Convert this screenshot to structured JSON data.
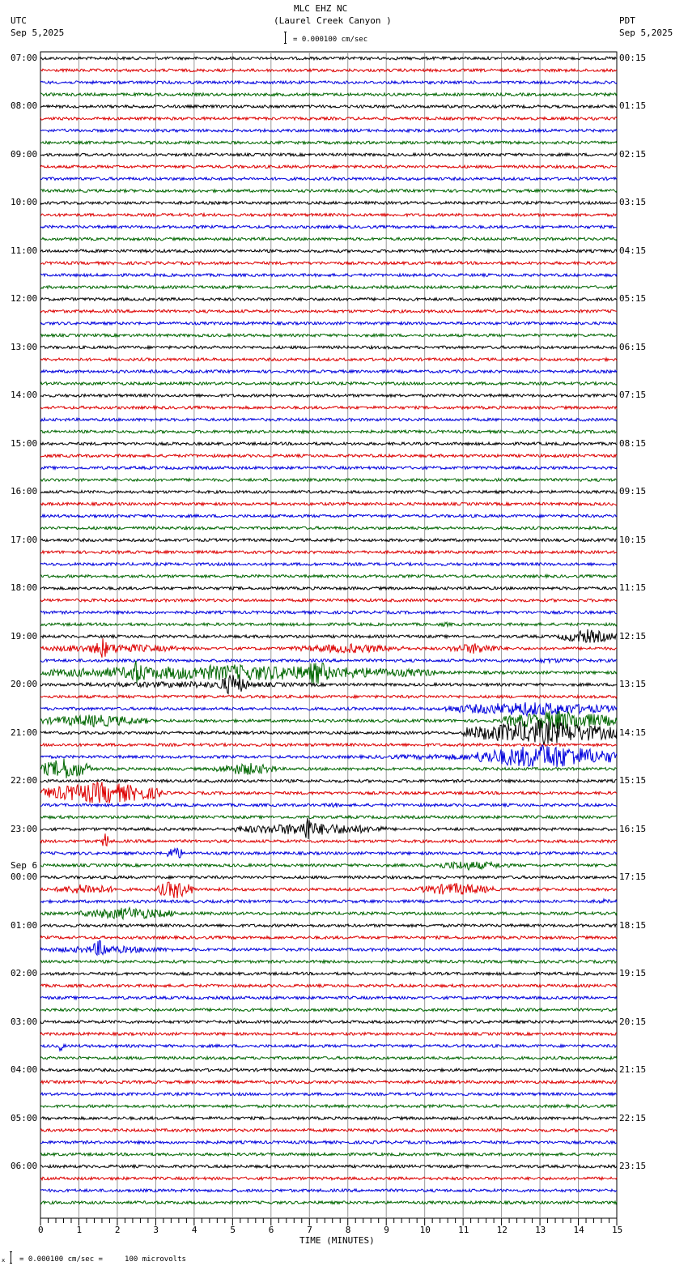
{
  "header": {
    "station": "MLC EHZ NC",
    "location": "(Laurel Creek Canyon )",
    "left_tz": "UTC",
    "left_date": "Sep 5,2025",
    "right_tz": "PDT",
    "right_date": "Sep 5,2025",
    "scale": "= 0.000100 cm/sec"
  },
  "footer": {
    "scale": "= 0.000100 cm/sec =     100 microvolts",
    "mark": "x"
  },
  "colors": [
    "#000000",
    "#dd0000",
    "#0000dd",
    "#006600"
  ],
  "chart_data": {
    "type": "line",
    "title": "MLC EHZ NC (Laurel Creek Canyon )",
    "xlabel": "TIME (MINUTES)",
    "xlim": [
      0,
      15
    ],
    "x_ticks": [
      "0",
      "1",
      "2",
      "3",
      "4",
      "5",
      "6",
      "7",
      "8",
      "9",
      "10",
      "11",
      "12",
      "13",
      "14",
      "15"
    ],
    "traces_per_hour": 4,
    "minutes_per_trace": 15,
    "next_day_label": "Sep 6",
    "next_day_hour_index": 17,
    "left_labels": [
      "07:00",
      "08:00",
      "09:00",
      "10:00",
      "11:00",
      "12:00",
      "13:00",
      "14:00",
      "15:00",
      "16:00",
      "17:00",
      "18:00",
      "19:00",
      "20:00",
      "21:00",
      "22:00",
      "23:00",
      "00:00",
      "01:00",
      "02:00",
      "03:00",
      "04:00",
      "05:00",
      "06:00"
    ],
    "right_labels": [
      "00:15",
      "01:15",
      "02:15",
      "03:15",
      "04:15",
      "05:15",
      "06:15",
      "07:15",
      "08:15",
      "09:15",
      "10:15",
      "11:15",
      "12:15",
      "13:15",
      "14:15",
      "15:15",
      "16:15",
      "17:15",
      "18:15",
      "19:15",
      "20:15",
      "21:15",
      "22:15",
      "23:15"
    ],
    "events": [
      {
        "trace": 22,
        "start": 4.6,
        "end": 5.0,
        "amplitude": 2
      },
      {
        "trace": 38,
        "start": 4.6,
        "end": 5.2,
        "amplitude": 2
      },
      {
        "trace": 47,
        "start": 10.3,
        "end": 10.8,
        "amplitude": 3
      },
      {
        "trace": 48,
        "start": 13.5,
        "end": 15,
        "amplitude": 9
      },
      {
        "trace": 49,
        "start": 0,
        "end": 3.8,
        "amplitude": 6
      },
      {
        "trace": 49,
        "start": 1.4,
        "end": 1.8,
        "amplitude": 14
      },
      {
        "trace": 49,
        "start": 6.5,
        "end": 9.6,
        "amplitude": 6
      },
      {
        "trace": 49,
        "start": 10.6,
        "end": 12,
        "amplitude": 7
      },
      {
        "trace": 50,
        "start": 11.5,
        "end": 15,
        "amplitude": 3
      },
      {
        "trace": 51,
        "start": 0,
        "end": 10.3,
        "amplitude": 10
      },
      {
        "trace": 51,
        "start": 2.2,
        "end": 2.8,
        "amplitude": 16
      },
      {
        "trace": 51,
        "start": 6.8,
        "end": 7.6,
        "amplitude": 16
      },
      {
        "trace": 52,
        "start": 0,
        "end": 8,
        "amplitude": 4
      },
      {
        "trace": 52,
        "start": 4.6,
        "end": 5.4,
        "amplitude": 14
      },
      {
        "trace": 54,
        "start": 10.5,
        "end": 15,
        "amplitude": 9
      },
      {
        "trace": 55,
        "start": 0,
        "end": 2.8,
        "amplitude": 8
      },
      {
        "trace": 55,
        "start": 12,
        "end": 15,
        "amplitude": 13
      },
      {
        "trace": 56,
        "start": 11,
        "end": 15,
        "amplitude": 16
      },
      {
        "trace": 58,
        "start": 8,
        "end": 15,
        "amplitude": 4
      },
      {
        "trace": 58,
        "start": 11.3,
        "end": 15,
        "amplitude": 16
      },
      {
        "trace": 59,
        "start": 0,
        "end": 1.3,
        "amplitude": 14
      },
      {
        "trace": 59,
        "start": 4.5,
        "end": 6.2,
        "amplitude": 8
      },
      {
        "trace": 61,
        "start": 0,
        "end": 3.2,
        "amplitude": 14
      },
      {
        "trace": 62,
        "start": 7.4,
        "end": 7.8,
        "amplitude": 4
      },
      {
        "trace": 64,
        "start": 5,
        "end": 9,
        "amplitude": 8
      },
      {
        "trace": 64,
        "start": 6.8,
        "end": 7.1,
        "amplitude": 20
      },
      {
        "trace": 65,
        "start": 1.6,
        "end": 1.8,
        "amplitude": 12
      },
      {
        "trace": 66,
        "start": 3.3,
        "end": 3.7,
        "amplitude": 10
      },
      {
        "trace": 67,
        "start": 10,
        "end": 12.2,
        "amplitude": 6
      },
      {
        "trace": 69,
        "start": 0.4,
        "end": 2,
        "amplitude": 7
      },
      {
        "trace": 69,
        "start": 3,
        "end": 4,
        "amplitude": 12
      },
      {
        "trace": 69,
        "start": 9.8,
        "end": 11.8,
        "amplitude": 8
      },
      {
        "trace": 70,
        "start": 14.3,
        "end": 15,
        "amplitude": 3
      },
      {
        "trace": 71,
        "start": 1,
        "end": 3.6,
        "amplitude": 8
      },
      {
        "trace": 74,
        "start": 0,
        "end": 3.5,
        "amplitude": 5
      },
      {
        "trace": 74,
        "start": 1.3,
        "end": 1.8,
        "amplitude": 12
      },
      {
        "trace": 82,
        "start": 0.45,
        "end": 0.6,
        "amplitude": 8
      }
    ]
  }
}
